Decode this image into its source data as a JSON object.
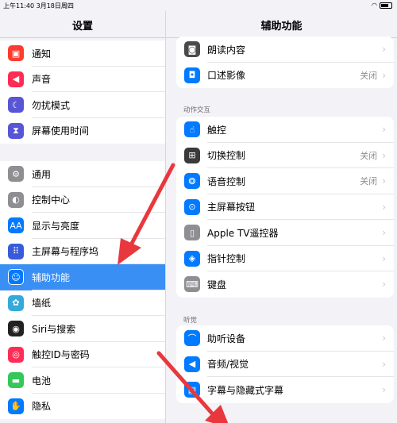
{
  "status": {
    "time": "上午11:40",
    "date": "3月18日周四"
  },
  "sidebar": {
    "title": "设置",
    "group1": [
      {
        "label": "通知",
        "icon": "notification-icon",
        "color": "#ff3b30",
        "glyph": "▣"
      },
      {
        "label": "声音",
        "icon": "speaker-icon",
        "color": "#ff2d55",
        "glyph": "◀"
      },
      {
        "label": "勿扰模式",
        "icon": "moon-icon",
        "color": "#5856d6",
        "glyph": "☾"
      },
      {
        "label": "屏幕使用时间",
        "icon": "hourglass-icon",
        "color": "#5856d6",
        "glyph": "⧗"
      }
    ],
    "group2": [
      {
        "label": "通用",
        "icon": "gear-icon",
        "color": "#8e8e93",
        "glyph": "⚙"
      },
      {
        "label": "控制中心",
        "icon": "toggles-icon",
        "color": "#8e8e93",
        "glyph": "◐"
      },
      {
        "label": "显示与亮度",
        "icon": "text-size-icon",
        "color": "#007aff",
        "glyph": "AA"
      },
      {
        "label": "主屏幕与程序坞",
        "icon": "grid-icon",
        "color": "#3a5bd9",
        "glyph": "⠿"
      },
      {
        "label": "辅助功能",
        "icon": "accessibility-icon",
        "color": "#007aff",
        "glyph": "☺"
      },
      {
        "label": "墙纸",
        "icon": "flower-icon",
        "color": "#34aadc",
        "glyph": "✿"
      },
      {
        "label": "Siri与搜索",
        "icon": "siri-icon",
        "color": "#222222",
        "glyph": "◉"
      },
      {
        "label": "触控ID与密码",
        "icon": "fingerprint-icon",
        "color": "#ff2d55",
        "glyph": "◎"
      },
      {
        "label": "电池",
        "icon": "battery-icon",
        "color": "#34c759",
        "glyph": "▬"
      },
      {
        "label": "隐私",
        "icon": "hand-icon",
        "color": "#007aff",
        "glyph": "✋"
      }
    ]
  },
  "main": {
    "title": "辅助功能",
    "card1": [
      {
        "label": "朗读内容",
        "value": "",
        "icon": "speech-bubble-icon",
        "color": "#4a4a4a",
        "glyph": "◙"
      },
      {
        "label": "口述影像",
        "value": "关闭",
        "icon": "audio-description-icon",
        "color": "#007aff",
        "glyph": "◘"
      }
    ],
    "section_interaction": "动作交互",
    "card2": [
      {
        "label": "触控",
        "value": "",
        "icon": "touch-hand-icon",
        "color": "#007aff",
        "glyph": "☝"
      },
      {
        "label": "切换控制",
        "value": "关闭",
        "icon": "switch-control-icon",
        "color": "#3a3a3c",
        "glyph": "⊞"
      },
      {
        "label": "语音控制",
        "value": "关闭",
        "icon": "voice-control-icon",
        "color": "#007aff",
        "glyph": "❂"
      },
      {
        "label": "主屏幕按钮",
        "value": "",
        "icon": "home-button-icon",
        "color": "#007aff",
        "glyph": "⊙"
      },
      {
        "label": "Apple TV遥控器",
        "value": "",
        "icon": "remote-icon",
        "color": "#8e8e93",
        "glyph": "▯"
      },
      {
        "label": "指针控制",
        "value": "",
        "icon": "pointer-icon",
        "color": "#007aff",
        "glyph": "◈"
      },
      {
        "label": "键盘",
        "value": "",
        "icon": "keyboard-icon",
        "color": "#8e8e93",
        "glyph": "⌨"
      }
    ],
    "section_hearing": "听觉",
    "card3": [
      {
        "label": "助听设备",
        "value": "",
        "icon": "ear-icon",
        "color": "#007aff",
        "glyph": "⌒"
      },
      {
        "label": "音频/视觉",
        "value": "",
        "icon": "audio-visual-icon",
        "color": "#007aff",
        "glyph": "◀"
      },
      {
        "label": "字幕与隐藏式字幕",
        "value": "",
        "icon": "subtitles-icon",
        "color": "#007aff",
        "glyph": "▤"
      }
    ],
    "chevron": "›"
  },
  "colors": {
    "selected": "#3a8ff5",
    "arrow": "#e8383d"
  }
}
